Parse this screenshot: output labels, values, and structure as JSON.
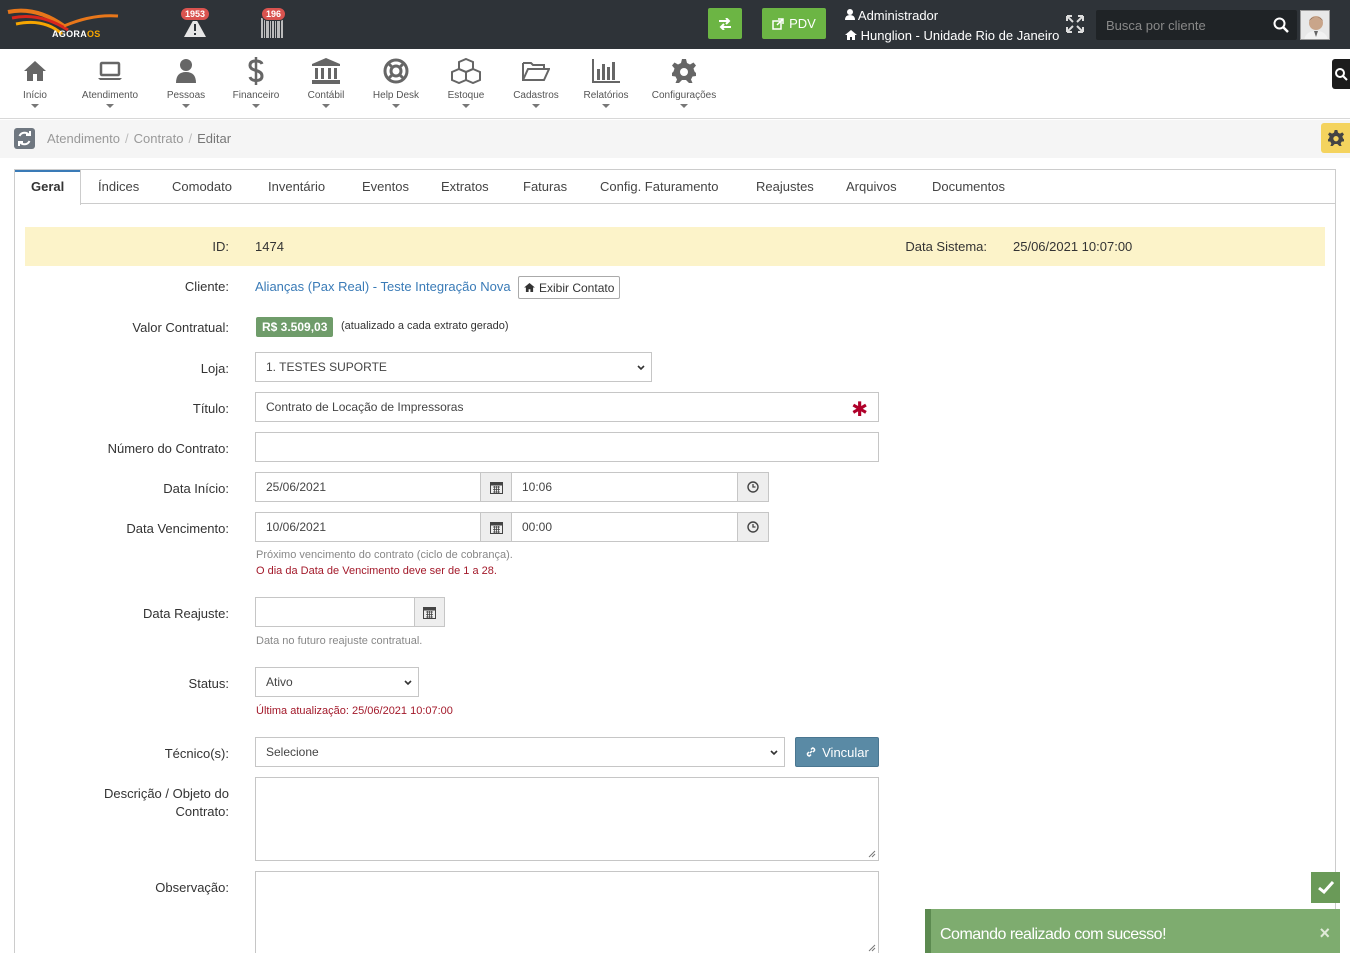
{
  "topbar": {
    "logo_text_a": "AGORA",
    "logo_text_b": "OS",
    "notifications": [
      {
        "count": "1953",
        "icon": "alert-triangle-icon"
      },
      {
        "count": "196",
        "icon": "barcode-icon"
      }
    ],
    "transfer_icon": "exchange-icon",
    "pdv_label": "PDV",
    "user_name": "Administrador",
    "unit_name": "Hunglion - Unidade Rio de Janeiro",
    "search_placeholder": "Busca por cliente"
  },
  "menu": [
    {
      "label": "Início",
      "icon": "home-icon"
    },
    {
      "label": "Atendimento",
      "icon": "laptop-icon"
    },
    {
      "label": "Pessoas",
      "icon": "user-icon"
    },
    {
      "label": "Financeiro",
      "icon": "dollar-icon"
    },
    {
      "label": "Contábil",
      "icon": "bank-icon"
    },
    {
      "label": "Help Desk",
      "icon": "lifebuoy-icon"
    },
    {
      "label": "Estoque",
      "icon": "cubes-icon"
    },
    {
      "label": "Cadastros",
      "icon": "folder-open-icon"
    },
    {
      "label": "Relatórios",
      "icon": "bar-chart-icon"
    },
    {
      "label": "Configurações",
      "icon": "gear-icon"
    }
  ],
  "breadcrumb": {
    "items": [
      "Atendimento",
      "Contrato"
    ],
    "active": "Editar",
    "separator": "/"
  },
  "tabs": [
    "Geral",
    "Índices",
    "Comodato",
    "Inventário",
    "Eventos",
    "Extratos",
    "Faturas",
    "Config. Faturamento",
    "Reajustes",
    "Arquivos",
    "Documentos"
  ],
  "form": {
    "id_label": "ID:",
    "id_value": "1474",
    "data_sistema_label": "Data Sistema:",
    "data_sistema_value": "25/06/2021 10:07:00",
    "cliente_label": "Cliente:",
    "cliente_value": "Alianças (Pax Real) - Teste Integração Nova",
    "exibir_contato_label": "Exibir Contato",
    "valor_label": "Valor Contratual:",
    "valor_value": "R$ 3.509,03",
    "valor_note": "(atualizado a cada extrato gerado)",
    "loja_label": "Loja:",
    "loja_value": "1. TESTES SUPORTE",
    "titulo_label": "Título:",
    "titulo_value": "Contrato de Locação de Impressoras",
    "numero_label": "Número do Contrato:",
    "numero_value": "",
    "inicio_label": "Data Início:",
    "inicio_date": "25/06/2021",
    "inicio_time": "10:06",
    "vencimento_label": "Data Vencimento:",
    "vencimento_date": "10/06/2021",
    "vencimento_time": "00:00",
    "vencimento_help": "Próximo vencimento do contrato (ciclo de cobrança).",
    "vencimento_error": "O dia da Data de Vencimento deve ser de 1 a 28.",
    "reajuste_label": "Data Reajuste:",
    "reajuste_value": "",
    "reajuste_help": "Data no futuro reajuste contratual.",
    "status_label": "Status:",
    "status_value": "Ativo",
    "status_note": "Última atualização: 25/06/2021 10:07:00",
    "tecnico_label": "Técnico(s):",
    "tecnico_value": "Selecione",
    "vincular_label": "Vincular",
    "descricao_label_1": "Descrição / Objeto do",
    "descricao_label_2": "Contrato:",
    "observacao_label": "Observação:"
  },
  "toast": {
    "message": "Comando realizado com sucesso!",
    "close": "×"
  },
  "colors": {
    "topbar": "#2e3338",
    "green": "#6cb544",
    "highlight_row": "#fcf3c9",
    "link": "#3a7bb7",
    "error": "#a3192a",
    "toast": "#7eac6f"
  }
}
